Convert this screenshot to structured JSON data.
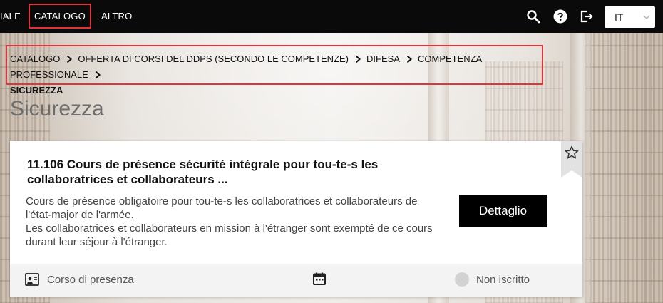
{
  "topbar": {
    "nav_items": [
      "IALE",
      "CATALOGO",
      "ALTRO"
    ],
    "language": "IT",
    "icons": [
      "search-icon",
      "help-icon",
      "logout-icon",
      "chevron-down-icon"
    ]
  },
  "breadcrumb": {
    "items": [
      "CATALOGO",
      "OFFERTA DI CORSI DEL DDPS (SECONDO LE COMPETENZE)",
      "DIFESA",
      "COMPETENZA PROFESSIONALE"
    ],
    "current": "SICUREZZA"
  },
  "page": {
    "title": "Sicurezza"
  },
  "course": {
    "title_line1": "11.106 Cours de présence sécurité intégrale pour tou-te-s les",
    "title_line2": "collaboratrices et collaborateurs ...",
    "description_line1": "Cours de présence obligatoire pour tou-te-s les collaboratrices et collaborateurs de",
    "description_line2": "l'état-major de l'armée.",
    "description_line3": "Les collaboratrices et collaborateurs en mission à l'étranger sont exempté de ce cours",
    "description_line4": "durant leur séjour à l'étranger.",
    "detail_button": "Dettaglio",
    "type": "Corso di presenza",
    "status": "Non iscritto"
  },
  "colors": {
    "topbar_bg": "#0a0a0a",
    "highlight": "#e0333a",
    "button_bg": "#000000",
    "footer_bg": "#f3f3f3"
  }
}
